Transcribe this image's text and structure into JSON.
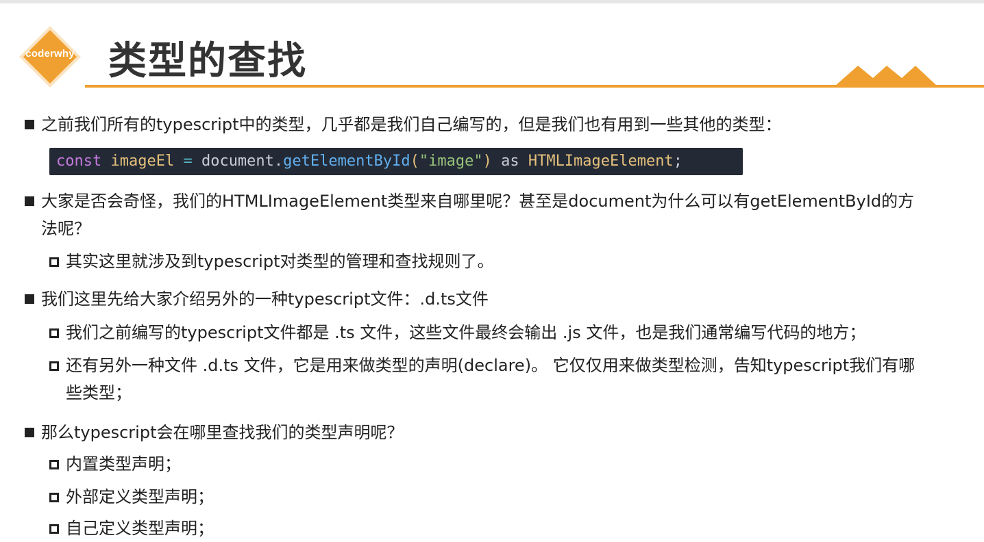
{
  "logo": {
    "text": "coderwhy"
  },
  "title": "类型的查找",
  "colors": {
    "accent": "#f0a030",
    "code_bg": "#232a36"
  },
  "code": {
    "kw": "const",
    "var": "imageEl",
    "op": "=",
    "obj": "document.",
    "fn": "getElementById",
    "paren_open": "(",
    "str": "\"image\"",
    "paren_close": ")",
    "as": "as",
    "type": "HTMLImageElement",
    "semi": ";"
  },
  "items": {
    "b1": "之前我们所有的typescript中的类型，几乎都是我们自己编写的，但是我们也有用到一些其他的类型：",
    "b2_line1": "大家是否会奇怪，我们的HTMLImageElement类型来自哪里呢？甚至是document为什么可以有getElementById的方",
    "b2_line2": "法呢？",
    "b2_sub1": "其实这里就涉及到typescript对类型的管理和查找规则了。",
    "b3": "我们这里先给大家介绍另外的一种typescript文件：.d.ts文件",
    "b3_sub1": "我们之前编写的typescript文件都是 .ts 文件，这些文件最终会输出 .js 文件，也是我们通常编写代码的地方；",
    "b3_sub2_line1": "还有另外一种文件 .d.ts 文件，它是用来做类型的声明(declare)。 它仅仅用来做类型检测，告知typescript我们有哪",
    "b3_sub2_line2": "些类型；",
    "b4": "那么typescript会在哪里查找我们的类型声明呢？",
    "b4_sub1": "内置类型声明；",
    "b4_sub2": "外部定义类型声明；",
    "b4_sub3": "自己定义类型声明；"
  }
}
